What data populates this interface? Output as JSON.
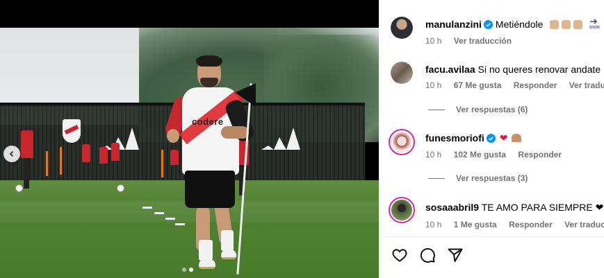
{
  "post": {
    "carousel_dots": 2,
    "active_dot": 1,
    "shirt_brand": "codere"
  },
  "comments": [
    {
      "username": "manulanzini",
      "verified": true,
      "text": "Metiéndole",
      "time": "10 h",
      "action": "Ver traducción",
      "avatar_color": "#3a3f46"
    },
    {
      "username": "facu.avilaa",
      "verified": false,
      "text": "Si no queres renovar andate",
      "time": "10 h",
      "likes": "67 Me gusta",
      "reply": "Responder",
      "action": "Ver traducción",
      "view_replies": "Ver respuestas (6)",
      "avatar_color": "#7d6a5e"
    },
    {
      "username": "funesmoriofi",
      "verified": true,
      "text": "",
      "time": "10 h",
      "likes": "102 Me gusta",
      "reply": "Responder",
      "view_replies": "Ver respuestas (3)",
      "avatar_color": "#c9c3bd"
    },
    {
      "username": "sosaaabril9",
      "verified": false,
      "text": "TE AMO PARA SIEMPRE",
      "time": "10 h",
      "likes": "1 Me gusta",
      "reply": "Responder",
      "action": "Ver traducción",
      "avatar_color": "#3d4a2f"
    }
  ],
  "icons": [
    "like-heart-icon",
    "comment-icon",
    "share-icon",
    "verified-badge-icon",
    "chevron-left-icon",
    "soon-arrow-icon"
  ],
  "colors": {
    "verified_blue": "#0095f6",
    "meta_gray": "#737373",
    "story_ring": "#d6249f",
    "heart_red": "#e01836"
  }
}
